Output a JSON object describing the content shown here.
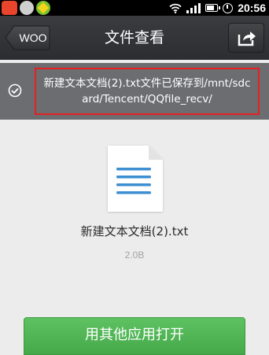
{
  "status_bar": {
    "time": "20:56",
    "icons": [
      "sogou-input-icon",
      "app-icon",
      "game-icon",
      "wifi-icon",
      "signal-icon",
      "battery-icon",
      "alarm-clock-icon"
    ]
  },
  "header": {
    "back_label": "WOO",
    "title": "文件查看",
    "share_icon": "share-icon"
  },
  "notice": {
    "text": "新建文本文档(2).txt文件已保存到/mnt/sdcard/Tencent/QQfile_recv/",
    "highlight_color": "#e42020"
  },
  "file": {
    "name": "新建文本文档(2).txt",
    "size": "2.0B",
    "icon": "text-document-icon"
  },
  "actions": {
    "open_with_label": "用其他应用打开",
    "accent_color": "#4cb351"
  }
}
